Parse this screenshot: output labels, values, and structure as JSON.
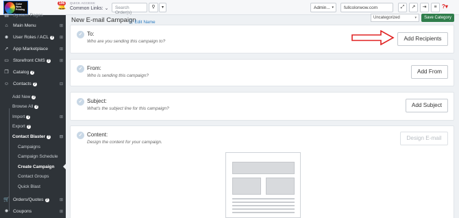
{
  "header": {
    "logo_text": "Color Wow Printing",
    "notif_count": "196",
    "quick_access_label": "QUICK ACCESS:",
    "common_links_label": "Common Links: ⌄",
    "search_placeholder": "Search Order(s)",
    "admin_label": "Admin...",
    "url": "fullcolorwow.com"
  },
  "sidebar": {
    "top_partial_label": "System Pages",
    "items": [
      {
        "icon": "home-icon",
        "label": "Main Menu"
      },
      {
        "icon": "user-icon",
        "label": "User Roles / ACL"
      },
      {
        "icon": "rocket-icon",
        "label": "App Marketplace"
      },
      {
        "icon": "monitor-icon",
        "label": "Storefront CMS"
      },
      {
        "icon": "cubes-icon",
        "label": "Catalog"
      },
      {
        "icon": "users-icon",
        "label": "Contacts"
      }
    ],
    "contacts_sub": [
      {
        "label": "Add New",
        "info": true,
        "arrow": false
      },
      {
        "label": "Browse All",
        "info": true,
        "arrow": false
      },
      {
        "label": "Import",
        "info": true,
        "arrow": true
      },
      {
        "label": "Export",
        "info": true,
        "arrow": false
      },
      {
        "label": "Contact Blaster",
        "info": true,
        "arrow": true,
        "active": true
      }
    ],
    "blaster_sub": [
      "Campaigns",
      "Campaign Schedule",
      "Create Campaign",
      "Contact Groups",
      "Quick Blast"
    ],
    "bottom_items": [
      {
        "icon": "cart-icon",
        "label": "Orders/Quotes"
      },
      {
        "icon": "coupon-icon",
        "label": "Coupons"
      }
    ]
  },
  "main": {
    "title": "New E-mail Campaign",
    "edit_name": "Edit Name",
    "category_value": "Uncategorized",
    "save_category": "Save Category",
    "sections": [
      {
        "title": "To:",
        "desc": "Who are you sending this campaign to?",
        "button": "Add Recipients"
      },
      {
        "title": "From:",
        "desc": "Who is sending this campaign?",
        "button": "Add From"
      },
      {
        "title": "Subject:",
        "desc": "What's the subject line for this campaign?",
        "button": "Add Subject"
      },
      {
        "title": "Content:",
        "desc": "Design the content for your campaign.",
        "button": "Design E-mail"
      }
    ]
  },
  "colors": {
    "sidebar_bg": "#2e3338",
    "save_green": "#2f7d4b",
    "arrow_red": "#e02020",
    "link_blue": "#2a7ac0"
  }
}
